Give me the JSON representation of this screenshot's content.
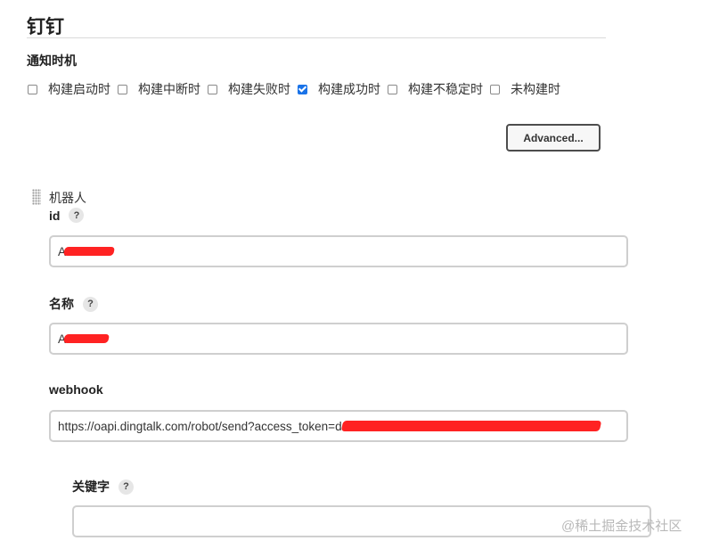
{
  "section": {
    "title": "钉钉",
    "notify_label": "通知时机"
  },
  "notify_options": [
    {
      "label": "构建启动时",
      "checked": false
    },
    {
      "label": "构建中断时",
      "checked": false
    },
    {
      "label": "构建失败时",
      "checked": false
    },
    {
      "label": "构建成功时",
      "checked": true
    },
    {
      "label": "构建不稳定时",
      "checked": false
    },
    {
      "label": "未构建时",
      "checked": false
    }
  ],
  "advanced_button": {
    "label": "Advanced..."
  },
  "robot": {
    "label": "机器人",
    "id": {
      "label": "id",
      "value_visible_prefix": "A"
    },
    "name": {
      "label": "名称",
      "value_visible_prefix": "A"
    },
    "webhook": {
      "label": "webhook",
      "value": "https://oapi.dingtalk.com/robot/send?access_token=d"
    },
    "keyword": {
      "label": "关键字",
      "value": ""
    }
  },
  "help_icon": "?",
  "watermark": "@稀土掘金技术社区"
}
